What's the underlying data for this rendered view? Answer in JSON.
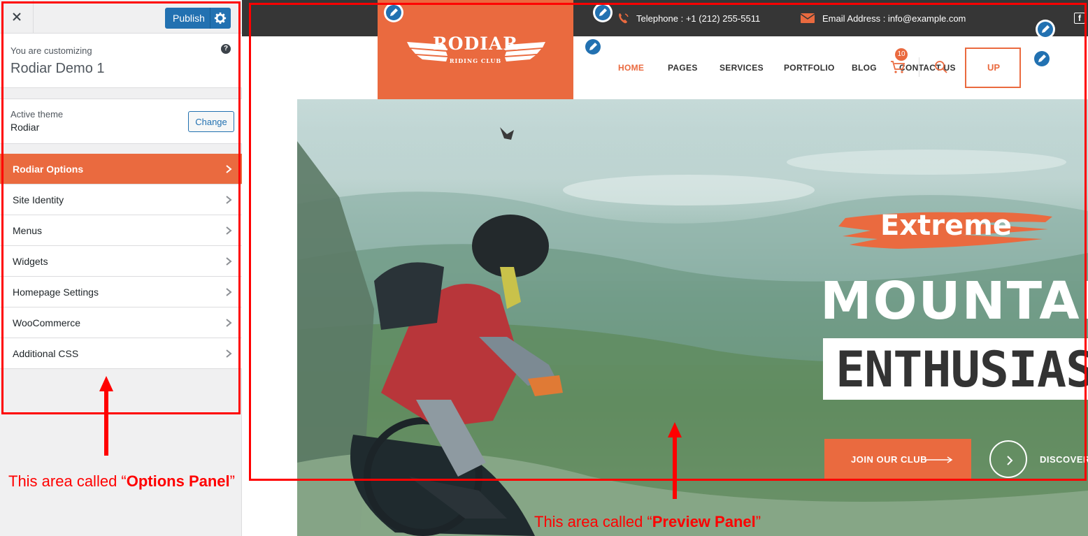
{
  "options_panel": {
    "close_icon": "close-icon",
    "publish_label": "Publish",
    "customizing_label": "You are customizing",
    "site_name": "Rodiar Demo 1",
    "active_theme_label": "Active theme",
    "active_theme_name": "Rodiar",
    "change_label": "Change",
    "menu_items": [
      {
        "label": "Rodiar Options",
        "active": true
      },
      {
        "label": "Site Identity",
        "active": false
      },
      {
        "label": "Menus",
        "active": false
      },
      {
        "label": "Widgets",
        "active": false
      },
      {
        "label": "Homepage Settings",
        "active": false
      },
      {
        "label": "WooCommerce",
        "active": false
      },
      {
        "label": "Additional CSS",
        "active": false
      }
    ]
  },
  "preview": {
    "telephone": "Telephone : +1 (212) 255-5511",
    "email": "Email Address : info@example.com",
    "logo_title": "RODIAR",
    "logo_subtitle": "RIDING CLUB",
    "nav": [
      "HOME",
      "PAGES",
      "SERVICES",
      "PORTFOLIO",
      "BLOG",
      "CONTACT US"
    ],
    "active_nav": "HOME",
    "cart_count": "10",
    "cta_label": "UP",
    "hero": {
      "tag": "Extreme",
      "title_line1": "MOUNTAIN",
      "title_line2": "ENTHUSIASTS",
      "join_label": "JOIN OUR CLUB",
      "discover_label": "DISCOVER"
    }
  },
  "annotations": {
    "options_prefix": "This area called “",
    "options_bold": "Options Panel",
    "options_suffix": "”",
    "preview_prefix": "This area called “",
    "preview_bold": "Preview Panel",
    "preview_suffix": "”"
  },
  "colors": {
    "accent": "#ea6a3f",
    "wp_blue": "#2271b1",
    "annotation_red": "#ff0000",
    "topbar_dark": "#363636"
  }
}
